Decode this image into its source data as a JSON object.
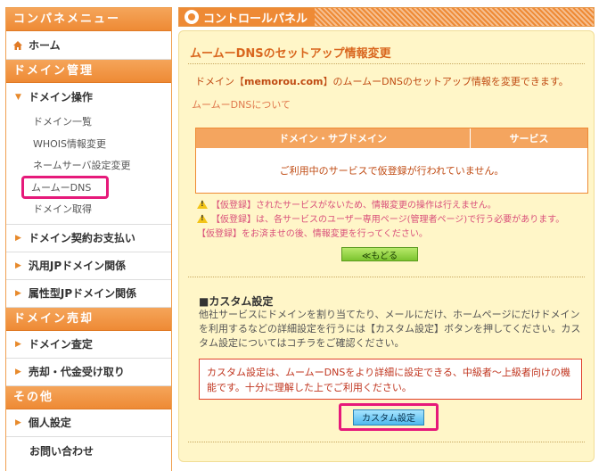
{
  "sidebar": {
    "title": "コンパネメニュー",
    "home": "ホーム",
    "section_domain": "ドメイン管理",
    "domain_ops": "ドメイン操作",
    "sub_items": [
      "ドメイン一覧",
      "WHOIS情報変更",
      "ネームサーバ設定変更",
      "ムームーDNS",
      "ドメイン取得"
    ],
    "contract": "ドメイン契約お支払い",
    "jp_general": "汎用JPドメイン関係",
    "jp_attr": "属性型JPドメイン関係",
    "section_sell": "ドメイン売却",
    "appraisal": "ドメイン査定",
    "sell_receive": "売却・代金受け取り",
    "section_other": "その他",
    "personal": "個人設定",
    "contact": "お問い合わせ"
  },
  "main": {
    "title": "コントロールパネル",
    "panel_title": "ムームーDNSのセットアップ情報変更",
    "intro_prefix": "ドメイン【",
    "intro_domain": "memorou.com",
    "intro_suffix": "】のムームーDNSのセットアップ情報を変更できます。",
    "about_link": "ムームーDNSについて",
    "table_headers": [
      "ドメイン・サブドメイン",
      "サービス"
    ],
    "table_empty": "ご利用中のサービスで仮登録が行われていません。",
    "warning1": "【仮登録】されたサービスがないため、情報変更の操作は行えません。",
    "warning2": "【仮登録】は、各サービスのユーザー専用ページ(管理者ページ)で行う必要があります。",
    "note": "【仮登録】をお済ませの後、情報変更を行ってください。",
    "back_button": "≪もどる",
    "custom_heading": "■カスタム設定",
    "custom_desc": "他社サービスにドメインを割り当てたり、メールにだけ、ホームページにだけドメインを利用するなどの詳細設定を行うには【カスタム設定】ボタンを押してください。カスタム設定についてはコチラをご確認ください。",
    "custom_warning": "カスタム設定は、ムームーDNSをより詳細に設定できる、中級者〜上級者向けの機能です。十分に理解した上でご利用ください。",
    "custom_button": "カスタム設定"
  },
  "colors": {
    "accent_orange": "#ee8a35",
    "panel_bg": "#fff6c8",
    "highlight_pink": "#e6197a"
  }
}
